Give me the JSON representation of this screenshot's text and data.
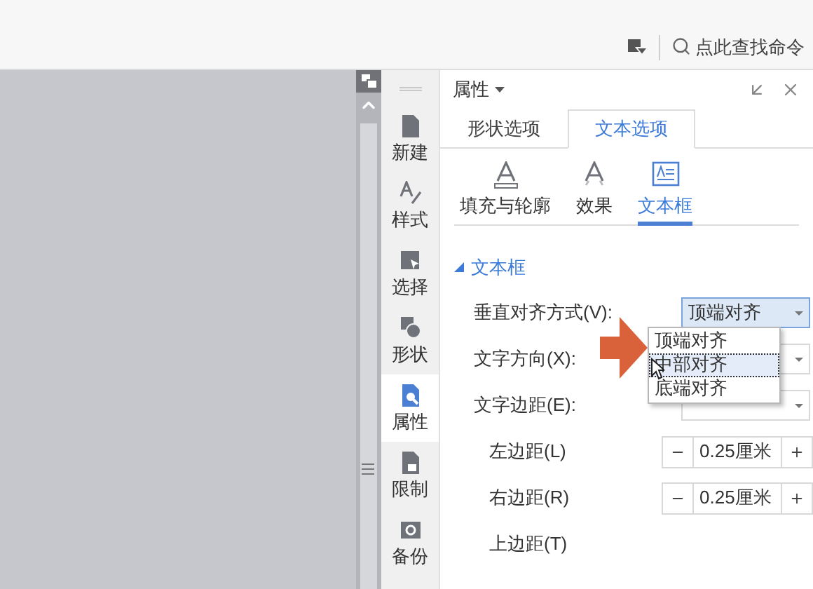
{
  "search": {
    "placeholder": "点此查找命令"
  },
  "sidebar": {
    "items": [
      {
        "label": "新建",
        "selected": false
      },
      {
        "label": "样式",
        "selected": false
      },
      {
        "label": "选择",
        "selected": false
      },
      {
        "label": "形状",
        "selected": false
      },
      {
        "label": "属性",
        "selected": true
      },
      {
        "label": "限制",
        "selected": false
      },
      {
        "label": "备份",
        "selected": false
      }
    ]
  },
  "panel": {
    "title": "属性",
    "tabs": [
      {
        "label": "形状选项",
        "selected": false
      },
      {
        "label": "文本选项",
        "selected": true
      }
    ],
    "subtabs": [
      {
        "label": "填充与轮廓",
        "selected": false
      },
      {
        "label": "效果",
        "selected": false
      },
      {
        "label": "文本框",
        "selected": true
      }
    ],
    "section": {
      "title": "文本框",
      "expanded": true
    },
    "fields": [
      {
        "kind": "select",
        "label": "垂直对齐方式(V):",
        "value": "顶端对齐",
        "open": true
      },
      {
        "kind": "select",
        "label": "文字方向(X):",
        "open": false
      },
      {
        "kind": "select",
        "label": "文字边距(E):",
        "open": false
      },
      {
        "kind": "spinner",
        "label": "左边距(L)",
        "value": "0.25厘米"
      },
      {
        "kind": "spinner",
        "label": "右边距(R)",
        "value": "0.25厘米"
      },
      {
        "kind": "label",
        "label": "上边距(T)"
      }
    ],
    "dropdown": {
      "options": [
        {
          "label": "顶端对齐",
          "selected": false
        },
        {
          "label": "中部对齐",
          "selected": true
        },
        {
          "label": "底端对齐",
          "selected": false
        }
      ]
    }
  }
}
